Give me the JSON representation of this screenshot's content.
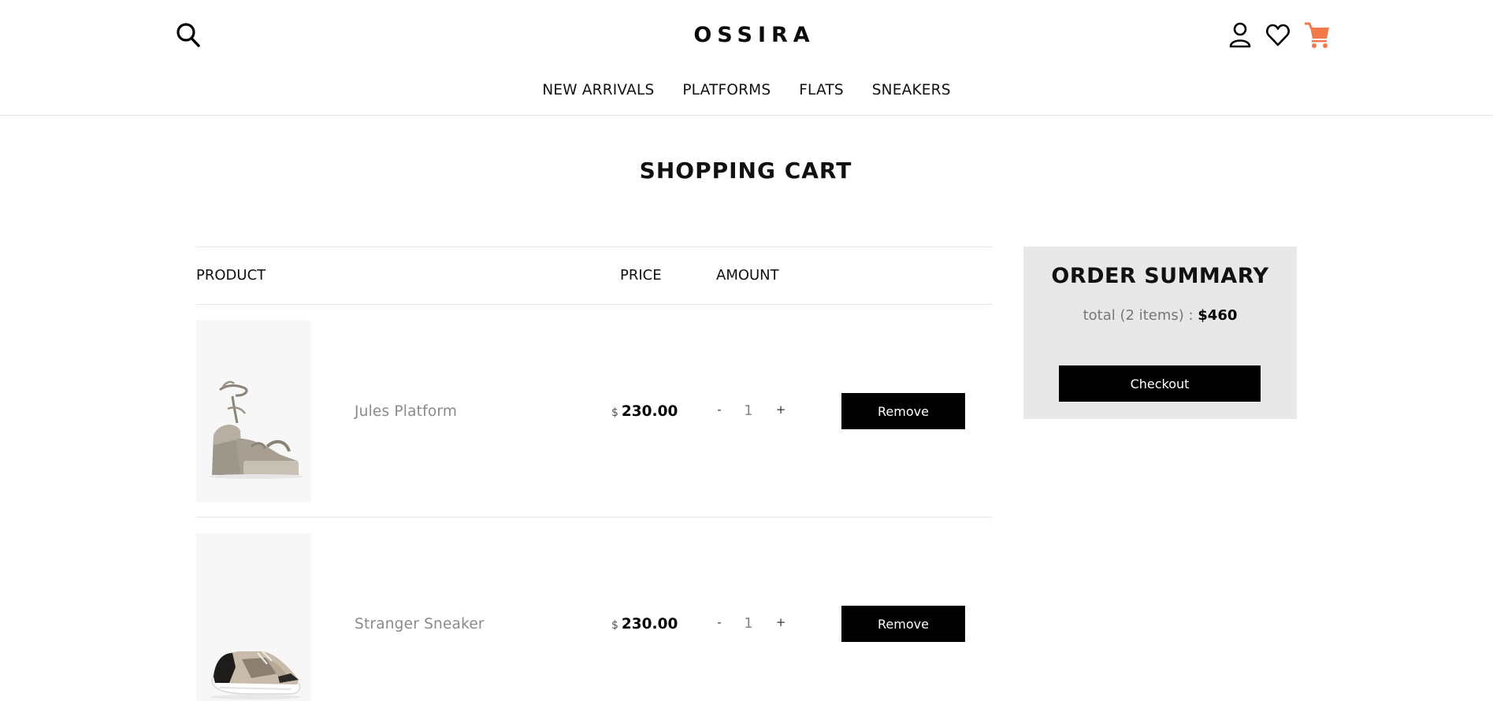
{
  "header": {
    "logo": "OSSIRA",
    "nav": [
      {
        "label": "NEW ARRIVALS"
      },
      {
        "label": "PLATFORMS"
      },
      {
        "label": "FLATS"
      },
      {
        "label": "SNEAKERS"
      }
    ],
    "icons": {
      "search": "search-icon",
      "account": "user-icon",
      "wishlist": "heart-icon",
      "cart": "cart-icon"
    },
    "cart_color": "#f07a4a"
  },
  "page": {
    "title": "SHOPPING CART"
  },
  "table": {
    "headers": {
      "product": "PRODUCT",
      "price": "PRICE",
      "amount": "AMOUNT"
    },
    "rows": [
      {
        "name": "Jules Platform",
        "currency": "$",
        "price": "230.00",
        "minus": "-",
        "quantity": "1",
        "plus": "+",
        "remove_label": "Remove"
      },
      {
        "name": "Stranger Sneaker",
        "currency": "$",
        "price": "230.00",
        "minus": "-",
        "quantity": "1",
        "plus": "+",
        "remove_label": "Remove"
      }
    ]
  },
  "summary": {
    "title": "ORDER SUMMARY",
    "total_label": "total (2 items) :",
    "total_amount": "$460",
    "checkout_label": "Checkout"
  }
}
